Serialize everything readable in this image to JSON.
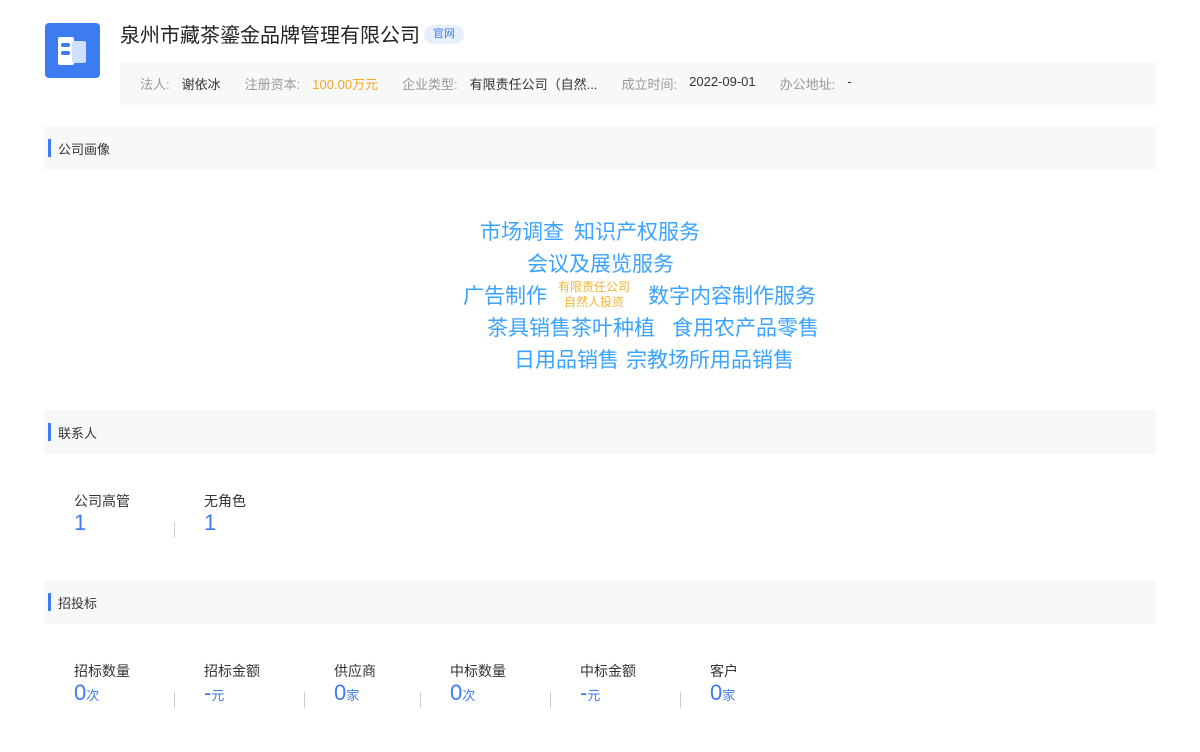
{
  "header": {
    "company_name": "泉州市藏茶鎏金品牌管理有限公司",
    "site_badge": "官网",
    "logo_icon": "company-building-icon",
    "accent_color": "#3d7cf0"
  },
  "info": {
    "legal_person_label": "法人:",
    "legal_person_value": "谢依冰",
    "capital_label": "注册资本:",
    "capital_value": "100.00万元",
    "type_label": "企业类型:",
    "type_value": "有限责任公司（自然...",
    "founded_label": "成立时间:",
    "founded_value": "2022-09-01",
    "address_label": "办公地址:",
    "address_value": "-"
  },
  "profile": {
    "title": "公司画像",
    "tags": {
      "t1": "市场调查",
      "t2": "知识产权服务",
      "t3": "会议及展览服务",
      "t4": "广告制作",
      "t5a": "有限责任公司",
      "t5b": "自然人投资",
      "t6": "数字内容制作服务",
      "t7": "茶具销售",
      "t8": "茶叶种植",
      "t9": "食用农产品零售",
      "t10": "日用品销售",
      "t11": "宗教场所用品销售"
    }
  },
  "contacts": {
    "title": "联系人",
    "stats": [
      {
        "label": "公司高管",
        "value": "1"
      },
      {
        "label": "无角色",
        "value": "1"
      }
    ]
  },
  "bidding": {
    "title": "招投标",
    "stats": [
      {
        "label": "招标数量",
        "value": "0",
        "unit": "次"
      },
      {
        "label": "招标金额",
        "value": "-",
        "unit": "元"
      },
      {
        "label": "供应商",
        "value": "0",
        "unit": "家"
      },
      {
        "label": "中标数量",
        "value": "0",
        "unit": "次"
      },
      {
        "label": "中标金额",
        "value": "-",
        "unit": "元"
      },
      {
        "label": "客户",
        "value": "0",
        "unit": "家"
      }
    ]
  }
}
